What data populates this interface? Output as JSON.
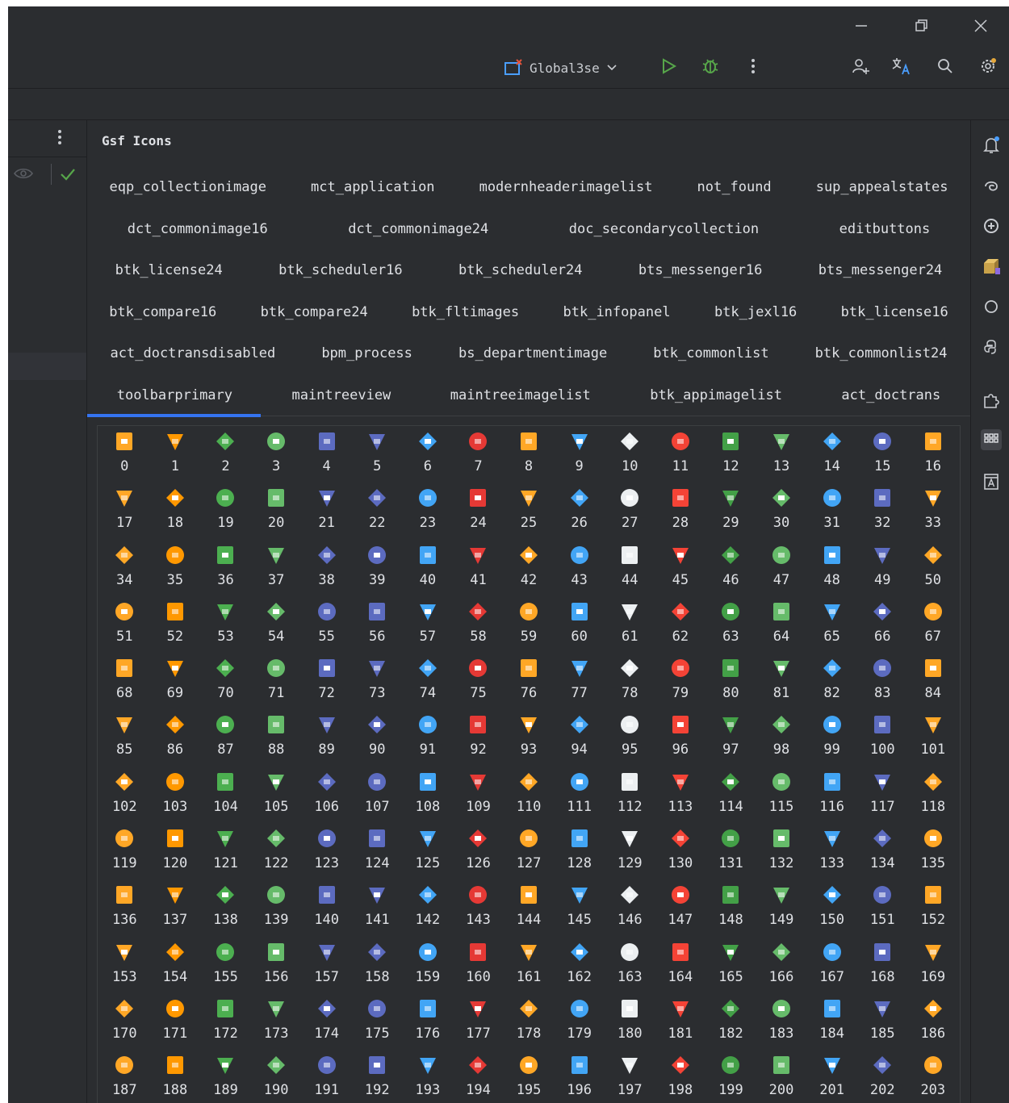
{
  "toolbar": {
    "run_config": "Global3se",
    "tooltips": {
      "run": "Run",
      "debug": "Debug",
      "more": "More",
      "profile": "Add user",
      "translate": "Translate",
      "search": "Search",
      "settings": "Settings"
    }
  },
  "panel": {
    "title": "Gsf Icons",
    "tab_rows": [
      [
        "eqp_collectionimage",
        "mct_application",
        "modernheaderimagelist",
        "not_found",
        "sup_appealstates"
      ],
      [
        "dct_commonimage16",
        "dct_commonimage24",
        "doc_secondarycollection",
        "editbuttons"
      ],
      [
        "btk_license24",
        "btk_scheduler16",
        "btk_scheduler24",
        "bts_messenger16",
        "bts_messenger24"
      ],
      [
        "btk_compare16",
        "btk_compare24",
        "btk_fltimages",
        "btk_infopanel",
        "btk_jexl16",
        "btk_license16"
      ],
      [
        "act_doctransdisabled",
        "bpm_process",
        "bs_departmentimage",
        "btk_commonlist",
        "btk_commonlist24"
      ],
      [
        "toolbarprimary",
        "maintreeview",
        "maintreeimagelist",
        "btk_appimagelist",
        "act_doctrans"
      ]
    ],
    "active_tab": "toolbarprimary",
    "accent": "#3574f0",
    "icon_count": 204
  }
}
